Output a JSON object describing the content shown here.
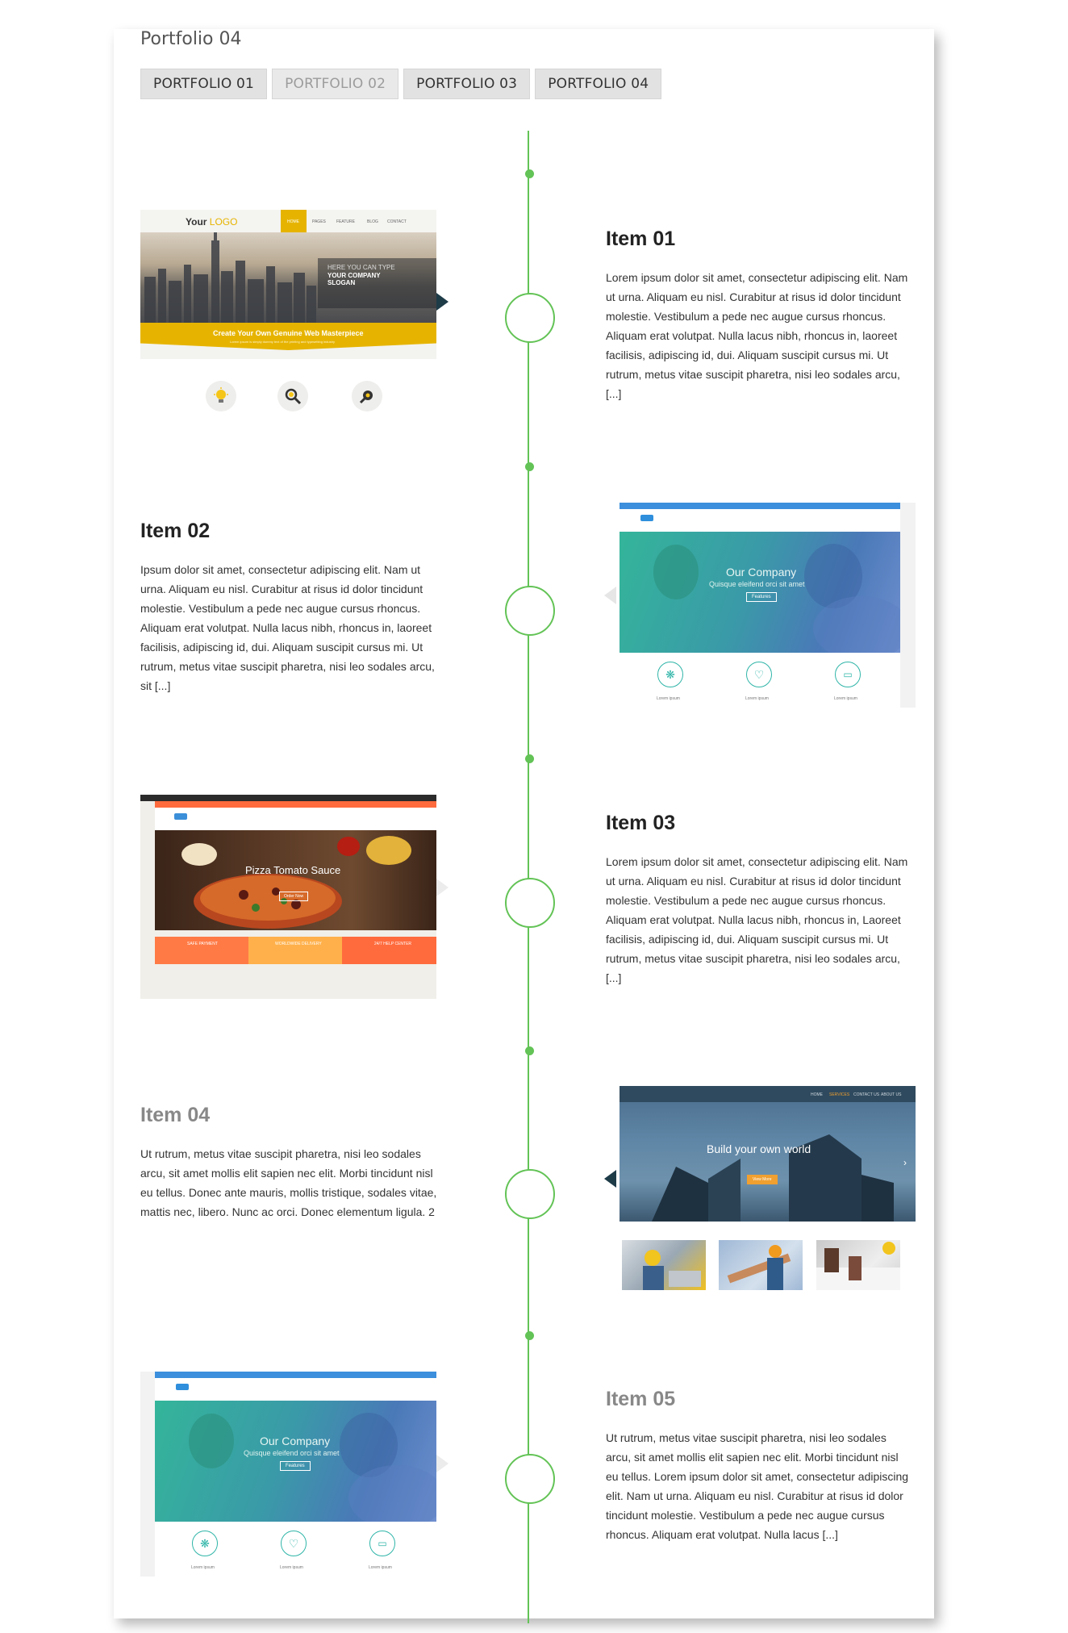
{
  "header": {
    "title": "Portfolio 04",
    "tabs": [
      {
        "label": "PORTFOLIO 01",
        "active": false
      },
      {
        "label": "PORTFOLIO 02",
        "active": false
      },
      {
        "label": "PORTFOLIO 03",
        "active": false
      },
      {
        "label": "PORTFOLIO 04",
        "active": true
      }
    ]
  },
  "colors": {
    "timeline": "#63c356",
    "accent_yellow": "#e6b400",
    "teal": "#2fb5a8",
    "orange": "#ff6b3d",
    "navy": "#2f4a5e"
  },
  "items": [
    {
      "title": "Item 01",
      "text": "Lorem ipsum dolor sit amet, consectetur adipiscing elit. Nam ut urna. Aliquam eu nisl. Curabitur at risus id dolor tincidunt molestie. Vestibulum a pede nec augue cursus rhoncus. Aliquam erat volutpat. Nulla lacus nibh, rhoncus in, laoreet facilisis, adipiscing id, dui. Aliquam suscipit cursus mi. Ut rutrum, metus vitae suscipit pharetra, nisi leo sodales arcu, [...]",
      "thumb": {
        "logo_your": "Your",
        "logo_word": "LOGO",
        "nav": [
          "HOME",
          "PAGES",
          "FEATURE",
          "BLOG",
          "CONTACT"
        ],
        "hero_small": "HERE YOU CAN TYPE",
        "hero_big": "YOUR COMPANY SLOGAN",
        "banner": "Create Your Own Genuine Web Masterpiece",
        "banner_sub": "Lorem ipsum is simply dummy text of the printing and typesetting industry",
        "icons": [
          "lightbulb-icon",
          "search-magnifier-icon",
          "gear-tools-icon"
        ]
      }
    },
    {
      "title": "Item 02",
      "text": "Ipsum dolor sit amet, consectetur adipiscing elit. Nam ut urna. Aliquam eu nisl. Curabitur at risus id dolor tincidunt molestie. Vestibulum a pede nec augue cursus rhoncus. Aliquam erat volutpat. Nulla lacus nibh, rhoncus in, laoreet facilisis, adipiscing id, dui. Aliquam suscipit cursus mi. Ut rutrum, metus vitae suscipit pharetra, nisi leo sodales arcu, sit [...]",
      "thumb": {
        "hero_title": "Our Company",
        "hero_sub": "Quisque eleifend orci sit amet",
        "button": "Features",
        "features": [
          "Lorem ipsum",
          "Lorem ipsum",
          "Lorem ipsum"
        ]
      }
    },
    {
      "title": "Item 03",
      "text": "Lorem ipsum dolor sit amet, consectetur adipiscing elit. Nam ut urna. Aliquam eu nisl. Curabitur at risus id dolor tincidunt molestie. Vestibulum a pede nec augue cursus rhoncus. Aliquam erat volutpat. Nulla lacus nibh, rhoncus in, Laoreet facilisis, adipiscing id, dui. Aliquam suscipit cursus mi. Ut rutrum, metus vitae suscipit pharetra, nisi leo sodales arcu, [...]",
      "thumb": {
        "hero_title": "Pizza Tomato Sauce",
        "button": "Order Now",
        "boxes": [
          "SAFE PAYMENT",
          "WORLDWIDE DELIVERY",
          "24/7 HELP CENTER"
        ]
      }
    },
    {
      "title": "Item 04",
      "text": "Ut rutrum, metus vitae suscipit pharetra, nisi leo sodales arcu, sit amet mollis elit sapien nec elit. Morbi tincidunt nisl eu tellus. Donec ante mauris, mollis tristique, sodales vitae, mattis nec, libero. Nunc ac orci. Donec elementum ligula. 2",
      "thumb": {
        "hero_title": "Build your own world",
        "button": "View More",
        "nav": [
          "HOME",
          "SERVICES",
          "CONTACT US",
          "ABOUT US"
        ]
      }
    },
    {
      "title": "Item 05",
      "text": "Ut rutrum, metus vitae suscipit pharetra, nisi leo sodales arcu, sit amet mollis elit sapien nec elit. Morbi tincidunt nisl eu tellus. Lorem ipsum dolor sit amet, consectetur adipiscing elit. Nam ut urna. Aliquam eu nisl. Curabitur at risus id dolor tincidunt molestie. Vestibulum a pede nec augue cursus rhoncus. Aliquam erat volutpat. Nulla lacus [...]",
      "thumb": {
        "hero_title": "Our Company",
        "hero_sub": "Quisque eleifend orci sit amet",
        "button": "Features",
        "features": [
          "Lorem ipsum",
          "Lorem ipsum",
          "Lorem ipsum"
        ]
      }
    }
  ]
}
